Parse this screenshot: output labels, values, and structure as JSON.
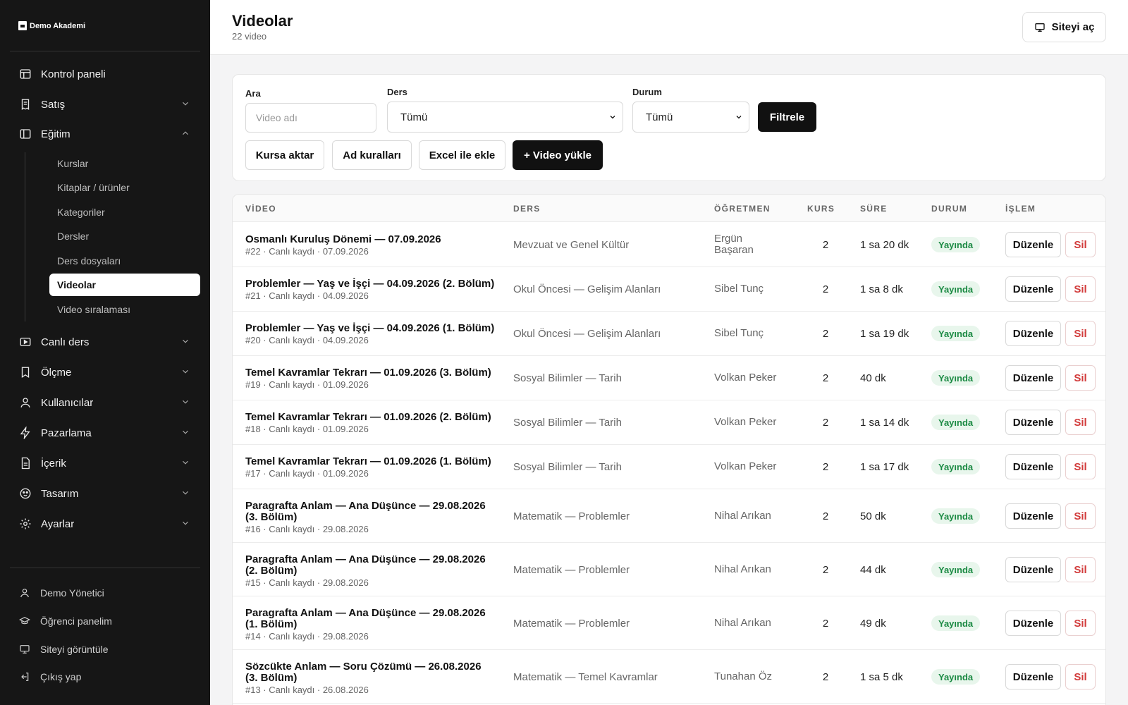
{
  "brand": {
    "name": "Demo Akademi"
  },
  "sidebar": {
    "items": [
      {
        "label": "Kontrol paneli",
        "icon": "layout-icon"
      },
      {
        "label": "Satış",
        "icon": "receipt-icon"
      },
      {
        "label": "Eğitim",
        "icon": "book-panel-icon"
      },
      {
        "label": "Canlı ders",
        "icon": "video-play-icon"
      },
      {
        "label": "Ölçme",
        "icon": "bookmark-icon"
      },
      {
        "label": "Kullanıcılar",
        "icon": "user-icon"
      },
      {
        "label": "Pazarlama",
        "icon": "bolt-icon"
      },
      {
        "label": "İçerik",
        "icon": "file-text-icon"
      },
      {
        "label": "Tasarım",
        "icon": "palette-icon"
      },
      {
        "label": "Ayarlar",
        "icon": "gear-icon"
      }
    ],
    "egitim_sub": [
      {
        "label": "Kurslar"
      },
      {
        "label": "Kitaplar / ürünler"
      },
      {
        "label": "Kategoriler"
      },
      {
        "label": "Dersler"
      },
      {
        "label": "Ders dosyaları"
      },
      {
        "label": "Videolar"
      },
      {
        "label": "Video sıralaması"
      }
    ],
    "footer": [
      {
        "label": "Demo Yönetici",
        "icon": "user-icon"
      },
      {
        "label": "Öğrenci panelim",
        "icon": "graduation-cap-icon"
      },
      {
        "label": "Siteyi görüntüle",
        "icon": "monitor-icon"
      },
      {
        "label": "Çıkış yap",
        "icon": "logout-icon"
      }
    ]
  },
  "header": {
    "title": "Videolar",
    "subtitle": "22 video",
    "open_site_label": "Siteyi aç"
  },
  "filters": {
    "search_label": "Ara",
    "search_placeholder": "Video adı",
    "ders_label": "Ders",
    "ders_value": "Tümü",
    "durum_label": "Durum",
    "durum_value": "Tümü",
    "filter_button": "Filtrele",
    "actions": [
      "Kursa aktar",
      "Ad kuralları",
      "Excel ile ekle",
      "+ Video yükle"
    ]
  },
  "table": {
    "columns": [
      "VİDEO",
      "DERS",
      "ÖĞRETMEN",
      "KURS",
      "SÜRE",
      "DURUM",
      "İŞLEM"
    ],
    "edit_label": "Düzenle",
    "delete_label": "Sil",
    "rows": [
      {
        "title": "Osmanlı Kuruluş Dönemi — 07.09.2026",
        "meta": "#22 · Canlı kaydı · 07.09.2026",
        "ders": "Mevzuat ve Genel Kültür",
        "ogretmen": "Ergün Başaran",
        "kurs": "2",
        "sure": "1 sa 20 dk",
        "durum": "Yayında"
      },
      {
        "title": "Problemler — Yaş ve İşçi — 04.09.2026 (2. Bölüm)",
        "meta": "#21 · Canlı kaydı · 04.09.2026",
        "ders": "Okul Öncesi — Gelişim Alanları",
        "ogretmen": "Sibel Tunç",
        "kurs": "2",
        "sure": "1 sa 8 dk",
        "durum": "Yayında"
      },
      {
        "title": "Problemler — Yaş ve İşçi — 04.09.2026 (1. Bölüm)",
        "meta": "#20 · Canlı kaydı · 04.09.2026",
        "ders": "Okul Öncesi — Gelişim Alanları",
        "ogretmen": "Sibel Tunç",
        "kurs": "2",
        "sure": "1 sa 19 dk",
        "durum": "Yayında"
      },
      {
        "title": "Temel Kavramlar Tekrarı — 01.09.2026 (3. Bölüm)",
        "meta": "#19 · Canlı kaydı · 01.09.2026",
        "ders": "Sosyal Bilimler — Tarih",
        "ogretmen": "Volkan Peker",
        "kurs": "2",
        "sure": "40 dk",
        "durum": "Yayında"
      },
      {
        "title": "Temel Kavramlar Tekrarı — 01.09.2026 (2. Bölüm)",
        "meta": "#18 · Canlı kaydı · 01.09.2026",
        "ders": "Sosyal Bilimler — Tarih",
        "ogretmen": "Volkan Peker",
        "kurs": "2",
        "sure": "1 sa 14 dk",
        "durum": "Yayında"
      },
      {
        "title": "Temel Kavramlar Tekrarı — 01.09.2026 (1. Bölüm)",
        "meta": "#17 · Canlı kaydı · 01.09.2026",
        "ders": "Sosyal Bilimler — Tarih",
        "ogretmen": "Volkan Peker",
        "kurs": "2",
        "sure": "1 sa 17 dk",
        "durum": "Yayında"
      },
      {
        "title": "Paragrafta Anlam — Ana Düşünce — 29.08.2026 (3. Bölüm)",
        "meta": "#16 · Canlı kaydı · 29.08.2026",
        "ders": "Matematik — Problemler",
        "ogretmen": "Nihal Arıkan",
        "kurs": "2",
        "sure": "50 dk",
        "durum": "Yayında"
      },
      {
        "title": "Paragrafta Anlam — Ana Düşünce — 29.08.2026 (2. Bölüm)",
        "meta": "#15 · Canlı kaydı · 29.08.2026",
        "ders": "Matematik — Problemler",
        "ogretmen": "Nihal Arıkan",
        "kurs": "2",
        "sure": "44 dk",
        "durum": "Yayında"
      },
      {
        "title": "Paragrafta Anlam — Ana Düşünce — 29.08.2026 (1. Bölüm)",
        "meta": "#14 · Canlı kaydı · 29.08.2026",
        "ders": "Matematik — Problemler",
        "ogretmen": "Nihal Arıkan",
        "kurs": "2",
        "sure": "49 dk",
        "durum": "Yayında"
      },
      {
        "title": "Sözcükte Anlam — Soru Çözümü — 26.08.2026 (3. Bölüm)",
        "meta": "#13 · Canlı kaydı · 26.08.2026",
        "ders": "Matematik — Temel Kavramlar",
        "ogretmen": "Tunahan Öz",
        "kurs": "2",
        "sure": "1 sa 5 dk",
        "durum": "Yayında"
      }
    ]
  },
  "colors": {
    "sidebar_bg": "#161616",
    "accent_dark": "#111111",
    "badge_green": "#1b8a43",
    "badge_green_bg": "#e8f6ec",
    "delete_red": "#d23b3b"
  }
}
